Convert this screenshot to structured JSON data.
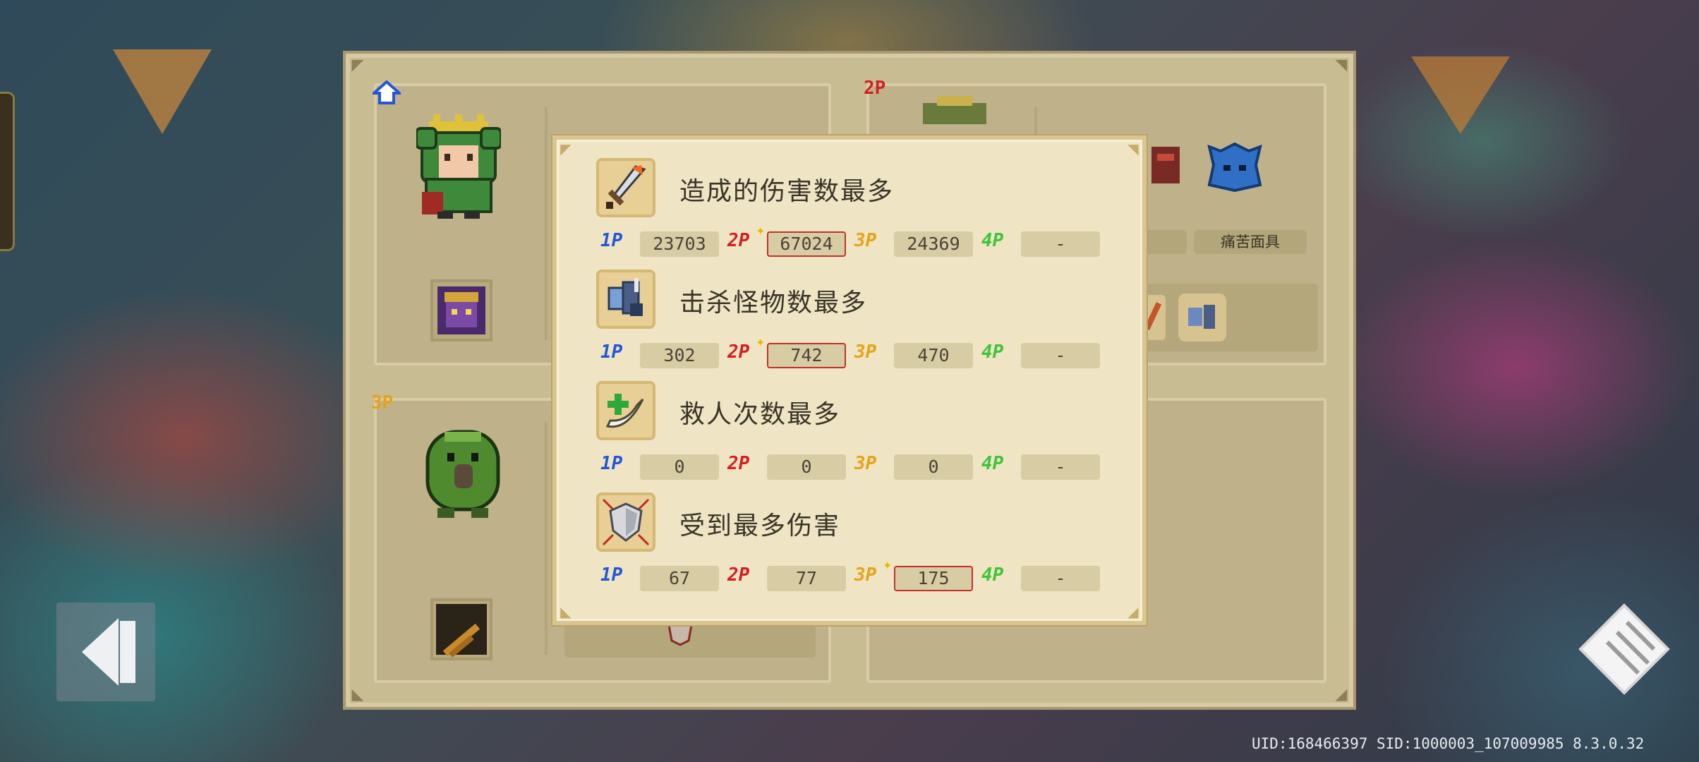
{
  "players": {
    "p2_label": "2P",
    "p3_label": "3P",
    "p2_item_tag_2": "痛苦面具"
  },
  "popup": {
    "stats": [
      {
        "title": "造成的伤害数最多",
        "icon": "sword-icon",
        "values": {
          "p1": "23703",
          "p2": "67024",
          "p3": "24369",
          "p4": "-"
        },
        "best": "p2"
      },
      {
        "title": "击杀怪物数最多",
        "icon": "kill-icon",
        "values": {
          "p1": "302",
          "p2": "742",
          "p3": "470",
          "p4": "-"
        },
        "best": "p2"
      },
      {
        "title": "救人次数最多",
        "icon": "revive-icon",
        "values": {
          "p1": "0",
          "p2": "0",
          "p3": "0",
          "p4": "-"
        },
        "best": null
      },
      {
        "title": "受到最多伤害",
        "icon": "shield-icon",
        "values": {
          "p1": "67",
          "p2": "77",
          "p3": "175",
          "p4": "-"
        },
        "best": "p3"
      }
    ],
    "player_labels": {
      "p1": "1P",
      "p2": "2P",
      "p3": "3P",
      "p4": "4P"
    }
  },
  "footer": {
    "uid_text": "UID:168466397 SID:1000003_107009985 8.3.0.32"
  },
  "colors": {
    "p1": "#2456d6",
    "p2": "#d41f25",
    "p3": "#e7a319",
    "p4": "#3fc43a",
    "best_border": "#c0332b"
  }
}
